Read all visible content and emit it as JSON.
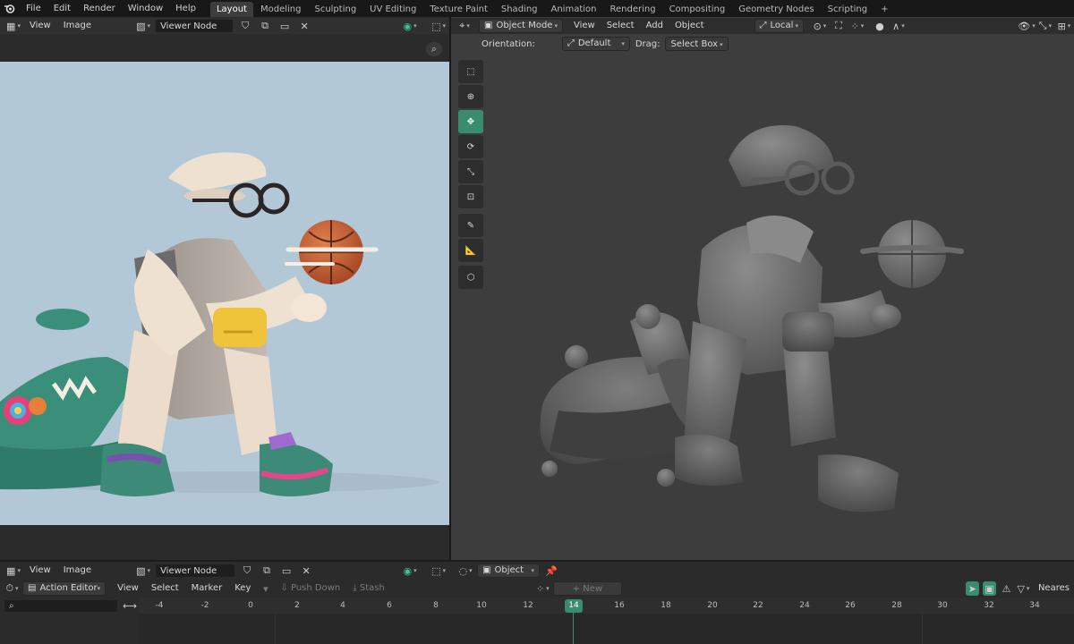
{
  "topbar": {
    "menus": [
      "File",
      "Edit",
      "Render",
      "Window",
      "Help"
    ],
    "workspaces": [
      "Layout",
      "Modeling",
      "Sculpting",
      "UV Editing",
      "Texture Paint",
      "Shading",
      "Animation",
      "Rendering",
      "Compositing",
      "Geometry Nodes",
      "Scripting"
    ],
    "active_workspace": "Layout",
    "add_tab": "+"
  },
  "image_editor": {
    "menus": [
      "View",
      "Image"
    ],
    "image_name": "Viewer Node"
  },
  "viewport": {
    "mode": "Object Mode",
    "menus": [
      "View",
      "Select",
      "Add",
      "Object"
    ],
    "transform_space": "Local",
    "orientation_label": "Orientation:",
    "orientation_value": "Default",
    "drag_label": "Drag:",
    "drag_value": "Select Box",
    "tools": [
      "select-box-tool",
      "cursor-tool",
      "move-tool",
      "rotate-tool",
      "scale-tool",
      "transform-tool",
      "annotate-tool",
      "measure-tool",
      "add-cube-tool"
    ]
  },
  "bottom_image_header": {
    "menus": [
      "View",
      "Image"
    ],
    "image_name": "Viewer Node",
    "object_label": "Object"
  },
  "action_editor": {
    "mode": "Action Editor",
    "menus": [
      "View",
      "Select",
      "Marker",
      "Key"
    ],
    "push_down": "Push Down",
    "stash": "Stash",
    "new_button": "New",
    "interpolation": "Neares"
  },
  "timeline": {
    "ticks": [
      "-4",
      "-2",
      "0",
      "2",
      "4",
      "6",
      "8",
      "10",
      "12",
      "14",
      "16",
      "18",
      "20",
      "22",
      "24",
      "26",
      "28",
      "30",
      "32",
      "34"
    ],
    "current_frame": "14"
  },
  "colors": {
    "accent": "#3a8c6e",
    "canvas_bg": "#b3c8d6",
    "viewport_bg": "#3d3d3d"
  }
}
